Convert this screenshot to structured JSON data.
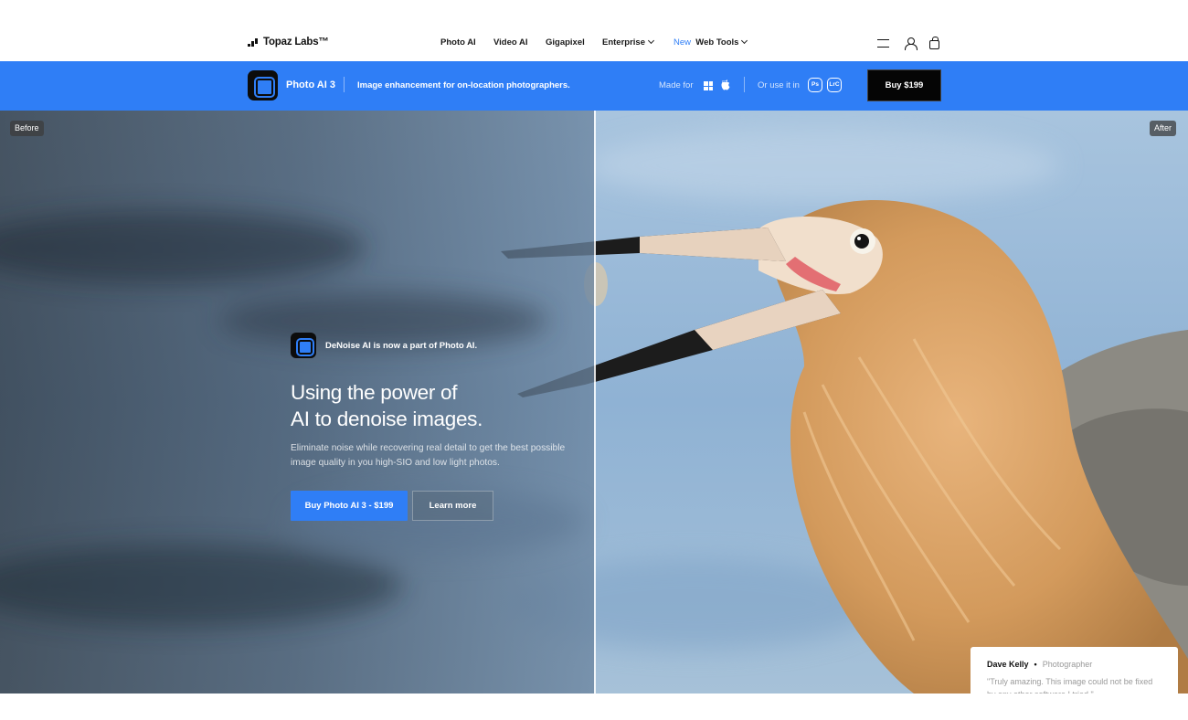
{
  "nav": {
    "brand": "Topaz Labs™",
    "items": [
      {
        "label": "Photo AI"
      },
      {
        "label": "Video AI"
      },
      {
        "label": "Gigapixel"
      },
      {
        "label": "Enterprise"
      },
      {
        "prefix": "New",
        "label": "Web Tools"
      }
    ],
    "icons": [
      "menu-icon",
      "user-icon",
      "cart-icon"
    ]
  },
  "product_bar": {
    "name": "Photo AI 3",
    "tagline": "Image enhancement for on-location photographers.",
    "made_for": "Made for",
    "platforms": [
      "windows-icon",
      "apple-icon"
    ],
    "or_use": "Or use it in",
    "plugins": [
      "Ps",
      "LrC"
    ],
    "buy_label": "Buy  $199",
    "accent": "#2f7ef6"
  },
  "hero": {
    "before_label": "Before",
    "after_label": "After",
    "badge_text": "DeNoise AI is now a part of Photo AI.",
    "headline_1": "Using the power of",
    "headline_2": "AI to denoise images.",
    "subtext": "Eliminate noise while recovering real detail to get the best possible image quality in you high-SIO and low light photos.",
    "primary_cta": "Buy Photo AI 3 - $199",
    "secondary_cta": "Learn more"
  },
  "testimonial": {
    "name": "Dave Kelly",
    "role": "Photographer",
    "quote": "\"Truly amazing. This image could not be fixed by any other software I tried.\""
  }
}
